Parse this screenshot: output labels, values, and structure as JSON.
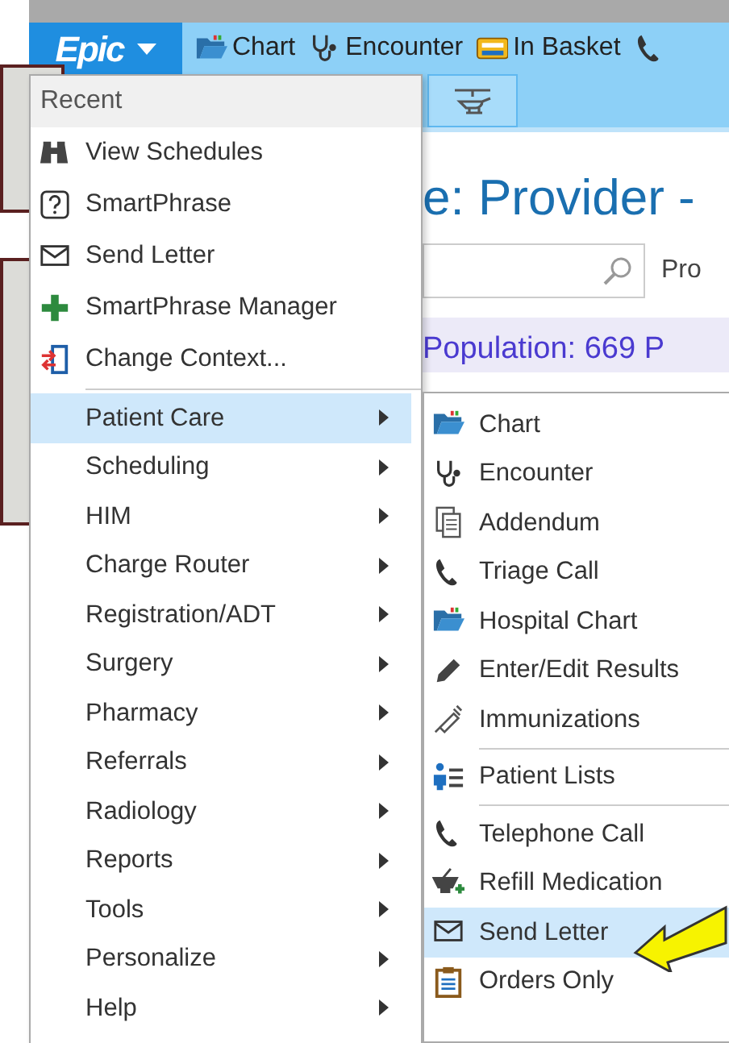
{
  "toolbar": {
    "logo": "Epic",
    "buttons": [
      {
        "label": "Chart"
      },
      {
        "label": "Encounter"
      },
      {
        "label": "In Basket"
      }
    ]
  },
  "content": {
    "title": "e: Provider -",
    "column_label": "Pro",
    "banner": "Population: 669 P"
  },
  "menu": {
    "header": "Recent",
    "recent": [
      {
        "label": "View Schedules"
      },
      {
        "label": "SmartPhrase"
      },
      {
        "label": "Send Letter"
      },
      {
        "label": "SmartPhrase Manager"
      },
      {
        "label": "Change Context..."
      }
    ],
    "items": [
      {
        "label": "Patient Care",
        "selected": true
      },
      {
        "label": "Scheduling",
        "selected": false
      },
      {
        "label": "HIM",
        "selected": false
      },
      {
        "label": "Charge Router",
        "selected": false
      },
      {
        "label": "Registration/ADT",
        "selected": false
      },
      {
        "label": "Surgery",
        "selected": false
      },
      {
        "label": "Pharmacy",
        "selected": false
      },
      {
        "label": "Referrals",
        "selected": false
      },
      {
        "label": "Radiology",
        "selected": false
      },
      {
        "label": "Reports",
        "selected": false
      },
      {
        "label": "Tools",
        "selected": false
      },
      {
        "label": "Personalize",
        "selected": false
      },
      {
        "label": "Help",
        "selected": false
      }
    ]
  },
  "submenu": {
    "items": [
      {
        "kind": "item",
        "label": "Chart",
        "selected": false
      },
      {
        "kind": "item",
        "label": "Encounter",
        "selected": false
      },
      {
        "kind": "item",
        "label": "Addendum",
        "selected": false
      },
      {
        "kind": "item",
        "label": "Triage Call",
        "selected": false
      },
      {
        "kind": "item",
        "label": "Hospital Chart",
        "selected": false
      },
      {
        "kind": "item",
        "label": "Enter/Edit Results",
        "selected": false
      },
      {
        "kind": "item",
        "label": "Immunizations",
        "selected": false
      },
      {
        "kind": "separator"
      },
      {
        "kind": "item",
        "label": "Patient Lists",
        "selected": false
      },
      {
        "kind": "separator"
      },
      {
        "kind": "item",
        "label": "Telephone Call",
        "selected": false
      },
      {
        "kind": "item",
        "label": "Refill Medication",
        "selected": false
      },
      {
        "kind": "item",
        "label": "Send Letter",
        "selected": true
      },
      {
        "kind": "item",
        "label": "Orders Only",
        "selected": false
      }
    ]
  }
}
